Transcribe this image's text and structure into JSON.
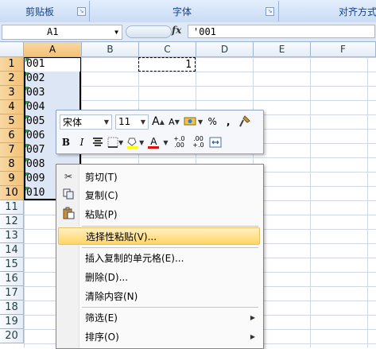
{
  "ribbon": {
    "groups": [
      {
        "label": "剪贴板"
      },
      {
        "label": "字体"
      },
      {
        "label": "对齐方式"
      }
    ]
  },
  "formula_bar": {
    "name_box": "A1",
    "fx_label": "fx",
    "content": "'001"
  },
  "sheet": {
    "columns": [
      "A",
      "B",
      "C",
      "D",
      "E",
      "F"
    ],
    "rows": [
      "1",
      "2",
      "3",
      "4",
      "5",
      "6",
      "7",
      "8",
      "9",
      "10",
      "11",
      "12",
      "13",
      "14",
      "15",
      "16",
      "17",
      "18",
      "19",
      "20"
    ],
    "column_a_values": [
      "001",
      "002",
      "003",
      "004",
      "005",
      "006",
      "007",
      "008",
      "009",
      "010"
    ],
    "c1_value": "1"
  },
  "mini_toolbar": {
    "font_name": "宋体",
    "font_size": "11",
    "grow_font": "A",
    "shrink_font": "A",
    "percent": "%",
    "comma": ",",
    "bold": "B",
    "italic": "I",
    "font_color_letter": "A",
    "inc_decimal": "+.0 .00",
    "dec_decimal": ".00 +.0"
  },
  "context_menu": {
    "items": [
      {
        "label": "剪切(T)",
        "icon": "scissors-icon"
      },
      {
        "label": "复制(C)",
        "icon": "copy-icon"
      },
      {
        "label": "粘贴(P)",
        "icon": "paste-icon"
      },
      {
        "label": "选择性粘贴(V)...",
        "highlighted": true
      },
      {
        "label": "插入复制的单元格(E)..."
      },
      {
        "label": "删除(D)..."
      },
      {
        "label": "清除内容(N)"
      },
      {
        "label": "筛选(E)",
        "submenu": true
      },
      {
        "label": "排序(O)",
        "submenu": true
      }
    ]
  },
  "colors": {
    "selection_fill": "#dce6f4",
    "header_selected": "#f3c276",
    "menu_highlight": "#ffd564",
    "ribbon_text": "#15428b"
  }
}
